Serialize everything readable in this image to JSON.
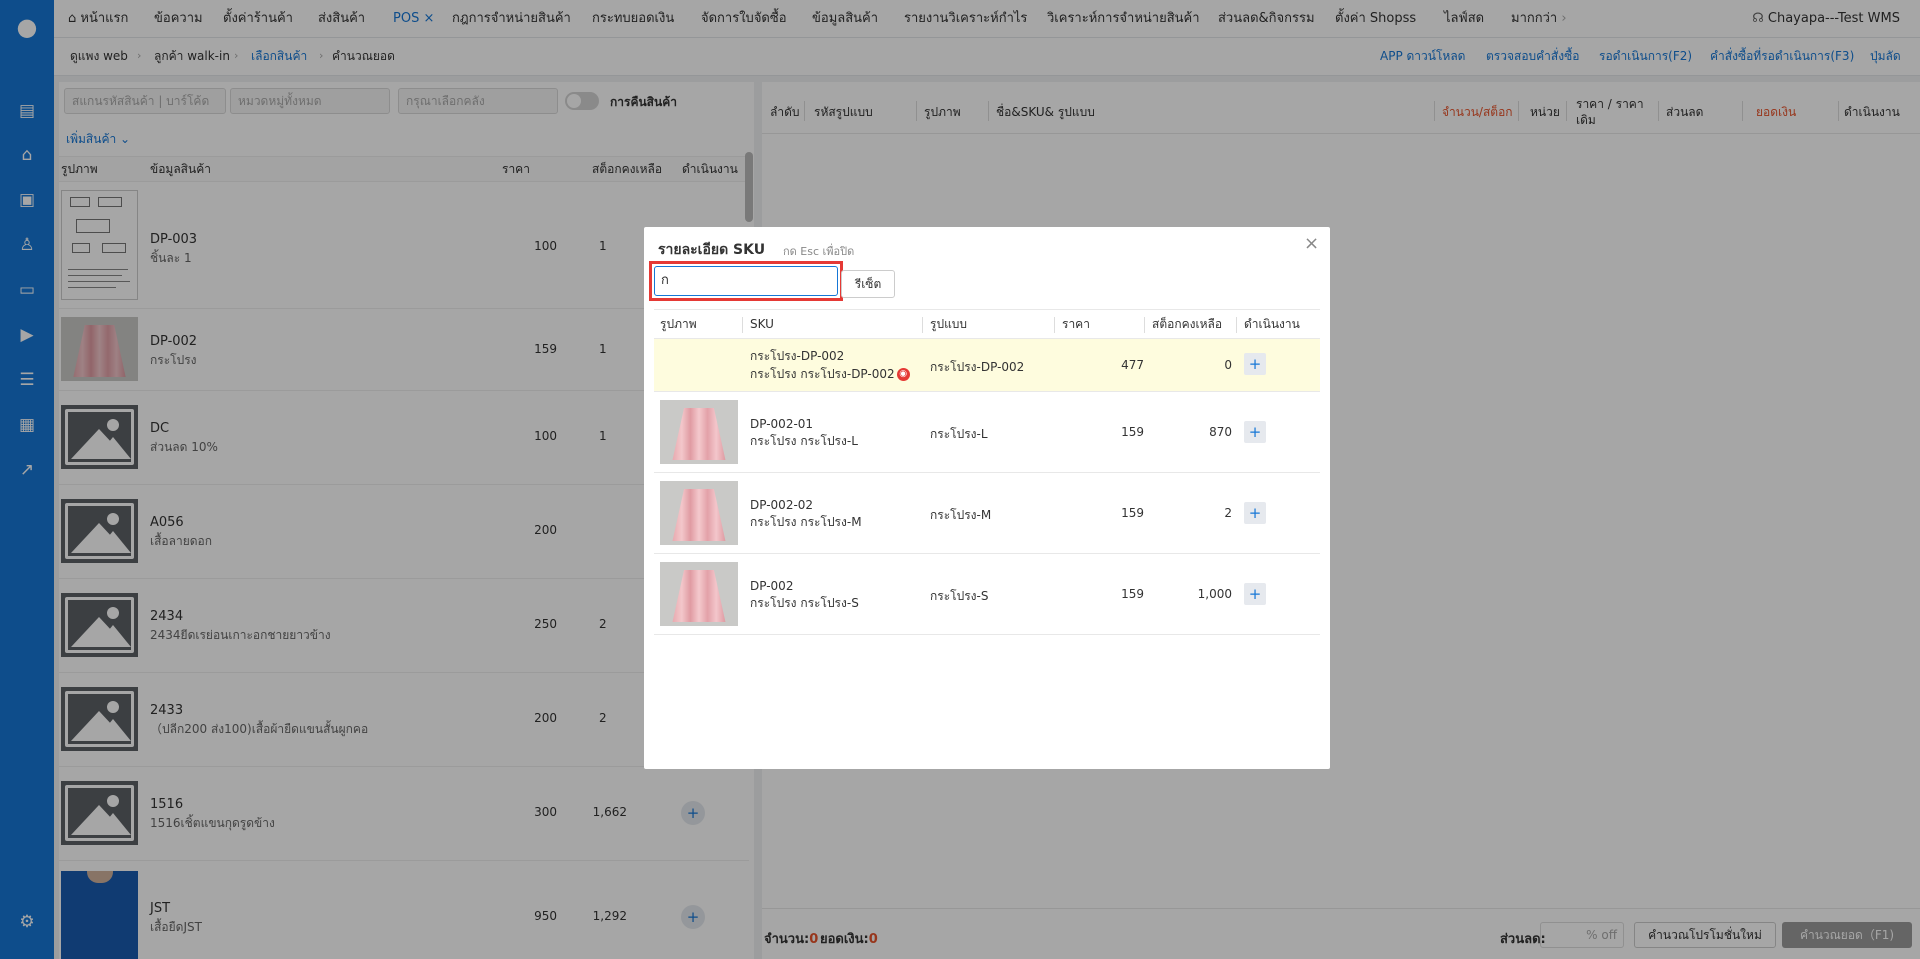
{
  "nav": {
    "home": "หน้าแรก",
    "items": [
      "ข้อความ",
      "ตั้งค่าร้านค้า",
      "ส่งสินค้า",
      "POS",
      "กฎการจำหน่ายสินค้า",
      "กระทบยอดเงิน",
      "จัดการใบจัดซื้อ",
      "ข้อมูลสินค้า",
      "รายงานวิเคราะห์กำไร",
      "วิเคราะห์การจำหน่ายสินค้า",
      "ส่วนลด&กิจกรรม",
      "ตั้งค่า Shopss",
      "ไลฟ์สด",
      "มากกว่า"
    ],
    "user": "Chayapa---Test WMS",
    "icons": [
      "headset-icon",
      "chevron-right-icon",
      "close-icon",
      "home-icon"
    ]
  },
  "subbar": {
    "crumbs": [
      "ดูแพง web",
      "ลูกค้า walk-in",
      "เลือกสินค้า",
      "คำนวณยอด"
    ],
    "links": [
      "APP ดาวน์โหลด",
      "ตรวจสอบคำสั่งซื้อ",
      "รอดำเนินการ(F2)",
      "คำสั่งซื้อที่รอดำเนินการ(F3)",
      "ปุ่มลัด"
    ]
  },
  "filters": {
    "scan_placeholder": "สแกนรหัสสินค้า | บาร์โค้ด",
    "category_placeholder": "หมวดหมู่ทั้งหมด",
    "warehouse_placeholder": "กรุณาเลือกคลัง",
    "return_label": "การคืนสินค้า",
    "add_product": "เพิ่มสินค้า"
  },
  "product_table": {
    "headers": [
      "รูปภาพ",
      "ข้อมูลสินค้า",
      "ราคา",
      "สต็อกคงเหลือ",
      "ดำเนินงาน"
    ],
    "rows": [
      {
        "name": "DP-003",
        "desc": "ชิ้นละ 1",
        "price": "100",
        "stock": "1"
      },
      {
        "name": "DP-002",
        "desc": "กระโปรง",
        "price": "159",
        "stock": "1"
      },
      {
        "name": "DC",
        "desc": "ส่วนลด 10%",
        "price": "100",
        "stock": "1"
      },
      {
        "name": "A056",
        "desc": "เสื้อลายดอก",
        "price": "200",
        "stock": ""
      },
      {
        "name": "2434",
        "desc": "2434ยีดเรย่อนเกาะอกชายยาวข้าง",
        "price": "250",
        "stock": "2"
      },
      {
        "name": "2433",
        "desc": "（ปลีก200 ส่ง100)เสื้อผ้ายืดแขนสั้นผูกคอ",
        "price": "200",
        "stock": "2"
      },
      {
        "name": "1516",
        "desc": "1516เชิ้ตแขนกุดรูดข้าง",
        "price": "300",
        "stock": "1,662"
      },
      {
        "name": "JST",
        "desc": "เสื้อยืดJST",
        "price": "950",
        "stock": "1,292"
      }
    ]
  },
  "order_table": {
    "headers": [
      "ลำดับ",
      "รหัสรูปแบบ",
      "รูปภาพ",
      "ชื่อ&SKU& รูปแบบ",
      "จำนวน/สต็อก",
      "หน่วย",
      "ราคา / ราคาเดิม",
      "ส่วนลด",
      "ยอดเงิน",
      "ดำเนินงาน"
    ],
    "colors": {
      "highlight": "#e8542c"
    }
  },
  "footer": {
    "qty_label": "จำนวน:",
    "qty_value": "0",
    "amount_label": "ยอดเงิน:",
    "amount_value": "0",
    "discount_label": "ส่วนลด:",
    "discount_placeholder": "% off",
    "recalc_button": "คำนวณโปรโมชั่นใหม่",
    "total_button": "คำนวณยอด（F1)"
  },
  "modal": {
    "title": "รายละเอียด SKU",
    "hint": "กด Esc เพื่อปิด",
    "search_value": "ก",
    "reset_button": "รีเซ็ต",
    "headers": [
      "รูปภาพ",
      "SKU",
      "รูปแบบ",
      "ราคา",
      "สต็อกคงเหลือ",
      "ดำเนินงาน"
    ],
    "rows": [
      {
        "sku1": "กระโปรง-DP-002",
        "sku2": "กระโปรง กระโปรง-DP-002",
        "variant": "กระโปรง-DP-002",
        "price": "477",
        "stock": "0",
        "badge": true
      },
      {
        "sku1": "DP-002-01",
        "sku2": "กระโปรง กระโปรง-L",
        "variant": "กระโปรง-L",
        "price": "159",
        "stock": "870"
      },
      {
        "sku1": "DP-002-02",
        "sku2": "กระโปรง กระโปรง-M",
        "variant": "กระโปรง-M",
        "price": "159",
        "stock": "2"
      },
      {
        "sku1": "DP-002",
        "sku2": "กระโปรง กระโปรง-S",
        "variant": "กระโปรง-S",
        "price": "159",
        "stock": "1,000"
      }
    ]
  },
  "colors": {
    "primary": "#1677d6",
    "sidebar": "#1677d6",
    "alert": "#e53935",
    "row_highlight": "#fefcde"
  }
}
